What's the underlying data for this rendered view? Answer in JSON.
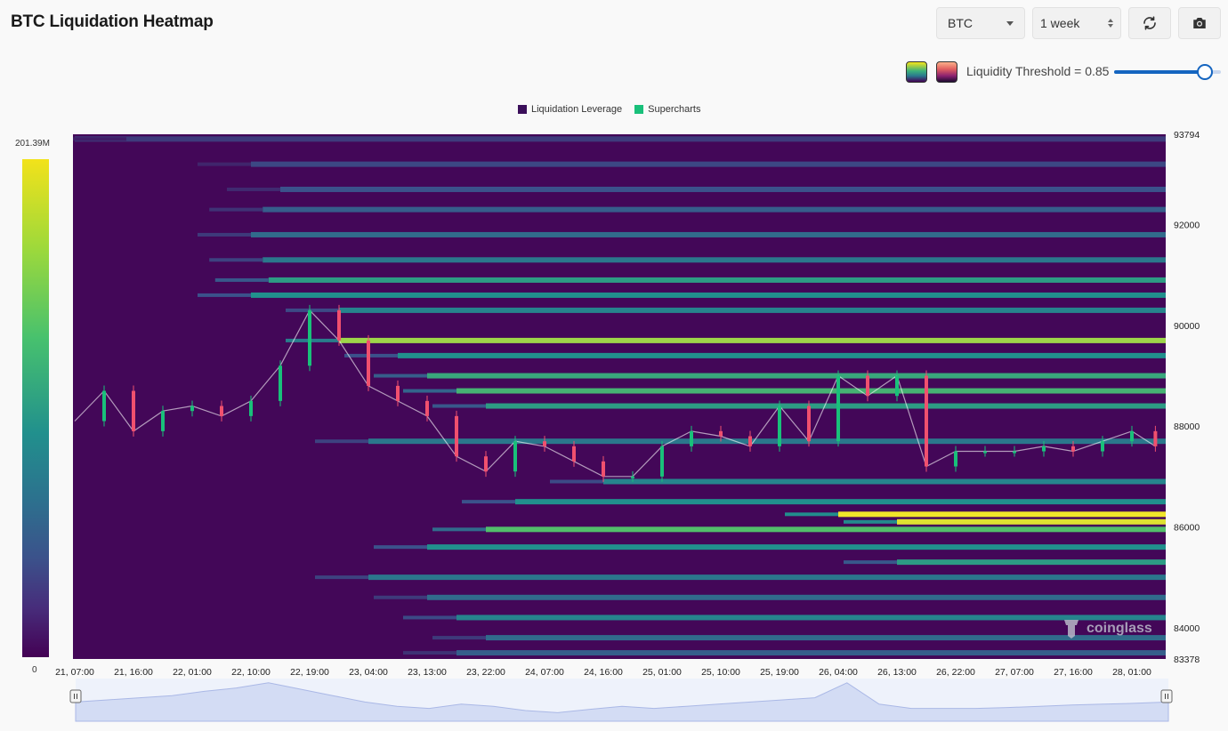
{
  "header": {
    "title": "BTC Liquidation Heatmap",
    "coin_select": "BTC",
    "range_select": "1 week"
  },
  "controls": {
    "threshold_label": "Liquidity Threshold = 0.85",
    "threshold_value": 0.85
  },
  "legend": {
    "items": [
      {
        "label": "Liquidation Leverage",
        "color": "#3b0f5a"
      },
      {
        "label": "Supercharts",
        "color": "#19c07a"
      }
    ]
  },
  "colorbar": {
    "max_label": "201.39M",
    "min_label": "0"
  },
  "watermark": "coinglass",
  "chart_data": {
    "type": "heatmap",
    "title": "BTC Liquidation Heatmap",
    "x_ticks": [
      "21, 07:00",
      "21, 16:00",
      "22, 01:00",
      "22, 10:00",
      "22, 19:00",
      "23, 04:00",
      "23, 13:00",
      "23, 22:00",
      "24, 07:00",
      "24, 16:00",
      "25, 01:00",
      "25, 10:00",
      "25, 19:00",
      "26, 04:00",
      "26, 13:00",
      "26, 22:00",
      "27, 07:00",
      "27, 16:00",
      "28, 01:00"
    ],
    "y_ticks": [
      93794,
      92000,
      90000,
      88000,
      86000,
      84000,
      83378
    ],
    "ylim": [
      83378,
      93794
    ],
    "colorscale": [
      "#440154",
      "#3b528b",
      "#21908d",
      "#5ec962",
      "#fde725"
    ],
    "price_series": {
      "name": "Supercharts",
      "x_index": [
        0,
        0.5,
        1,
        1.5,
        2,
        2.5,
        3,
        3.5,
        4,
        4.5,
        5,
        5.5,
        6,
        6.5,
        7,
        7.5,
        8,
        8.5,
        9,
        9.5,
        10,
        10.5,
        11,
        11.5,
        12,
        12.5,
        13,
        13.5,
        14,
        14.5,
        15,
        15.5,
        16,
        16.5,
        17,
        17.5,
        18,
        18.4
      ],
      "close": [
        88100,
        88700,
        87900,
        88300,
        88400,
        88200,
        88500,
        89200,
        90300,
        89700,
        88800,
        88500,
        88200,
        87400,
        87100,
        87700,
        87600,
        87300,
        87000,
        87000,
        87600,
        87900,
        87800,
        87600,
        88400,
        87700,
        89000,
        88600,
        89000,
        87200,
        87500,
        87500,
        87500,
        87600,
        87500,
        87700,
        87900,
        87600
      ]
    },
    "bands": [
      {
        "price": 93700,
        "start": 0.0,
        "intensity": 0.18
      },
      {
        "price": 93200,
        "start": 3.0,
        "intensity": 0.22
      },
      {
        "price": 92700,
        "start": 3.5,
        "intensity": 0.25
      },
      {
        "price": 92300,
        "start": 3.2,
        "intensity": 0.3
      },
      {
        "price": 91800,
        "start": 3.0,
        "intensity": 0.35
      },
      {
        "price": 91300,
        "start": 3.2,
        "intensity": 0.4
      },
      {
        "price": 90900,
        "start": 3.3,
        "intensity": 0.55
      },
      {
        "price": 90600,
        "start": 3.0,
        "intensity": 0.5
      },
      {
        "price": 90300,
        "start": 4.5,
        "intensity": 0.45
      },
      {
        "price": 89700,
        "start": 4.5,
        "intensity": 0.85
      },
      {
        "price": 89400,
        "start": 5.5,
        "intensity": 0.5
      },
      {
        "price": 89000,
        "start": 6.0,
        "intensity": 0.6
      },
      {
        "price": 88700,
        "start": 6.5,
        "intensity": 0.65
      },
      {
        "price": 88400,
        "start": 7.0,
        "intensity": 0.55
      },
      {
        "price": 87700,
        "start": 5.0,
        "intensity": 0.4
      },
      {
        "price": 86900,
        "start": 9.0,
        "intensity": 0.45
      },
      {
        "price": 86500,
        "start": 7.5,
        "intensity": 0.5
      },
      {
        "price": 86250,
        "start": 13.0,
        "intensity": 0.98
      },
      {
        "price": 86100,
        "start": 14.0,
        "intensity": 0.95
      },
      {
        "price": 85950,
        "start": 7.0,
        "intensity": 0.7
      },
      {
        "price": 85600,
        "start": 6.0,
        "intensity": 0.5
      },
      {
        "price": 85300,
        "start": 14.0,
        "intensity": 0.55
      },
      {
        "price": 85000,
        "start": 5.0,
        "intensity": 0.4
      },
      {
        "price": 84600,
        "start": 6.0,
        "intensity": 0.35
      },
      {
        "price": 84200,
        "start": 6.5,
        "intensity": 0.45
      },
      {
        "price": 83800,
        "start": 7.0,
        "intensity": 0.35
      },
      {
        "price": 83500,
        "start": 6.5,
        "intensity": 0.3
      }
    ],
    "navigator_values": [
      0.45,
      0.5,
      0.55,
      0.6,
      0.7,
      0.78,
      0.9,
      0.75,
      0.6,
      0.45,
      0.35,
      0.3,
      0.4,
      0.35,
      0.25,
      0.2,
      0.28,
      0.35,
      0.3,
      0.35,
      0.4,
      0.45,
      0.5,
      0.55,
      0.9,
      0.4,
      0.3,
      0.3,
      0.3,
      0.32,
      0.35,
      0.38,
      0.4,
      0.42,
      0.45
    ]
  }
}
